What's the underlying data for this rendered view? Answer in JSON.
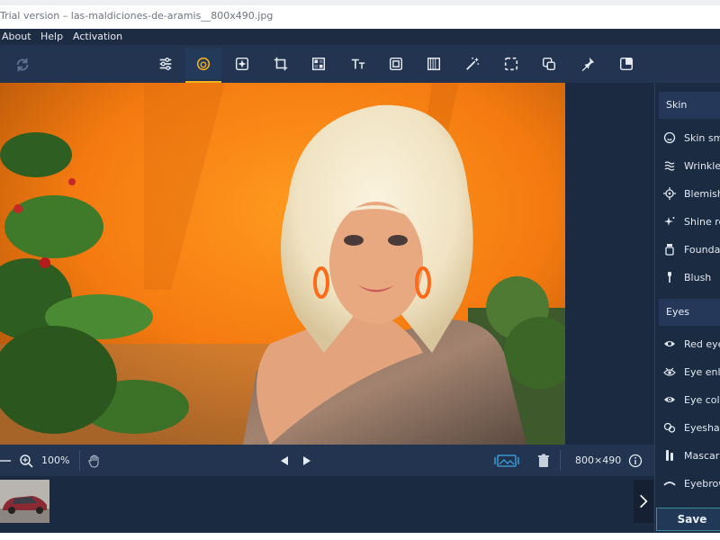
{
  "window": {
    "title": "Trial version – las-maldiciones-de-aramis__800x490.jpg"
  },
  "menu": {
    "items": [
      "About",
      "Help",
      "Activation"
    ]
  },
  "toolbar": {
    "undo_icon": "redo-icon",
    "tools": [
      {
        "name": "adjust-tool",
        "icon": "sliders-icon"
      },
      {
        "name": "retouch-tool",
        "icon": "face-retouch-icon",
        "active": true
      },
      {
        "name": "enhance-tool",
        "icon": "enhance-icon"
      },
      {
        "name": "crop-tool",
        "icon": "crop-icon"
      },
      {
        "name": "effects-tool",
        "icon": "effects-icon"
      },
      {
        "name": "text-tool",
        "icon": "text-icon"
      },
      {
        "name": "frame-tool",
        "icon": "frame-icon"
      },
      {
        "name": "vignette-tool",
        "icon": "vignette-icon"
      },
      {
        "name": "magic-wand-tool",
        "icon": "magic-wand-icon"
      },
      {
        "name": "selection-tool",
        "icon": "selection-icon"
      },
      {
        "name": "replace-tool",
        "icon": "replace-icon"
      },
      {
        "name": "pin-tool",
        "icon": "pin-icon"
      },
      {
        "name": "transform-tool",
        "icon": "transform-icon"
      }
    ],
    "accent_color": "#f2b01d"
  },
  "panel": {
    "skin_header": "Skin",
    "skin_items": [
      "Skin smo",
      "Wrinkle r",
      "Blemish",
      "Shine re",
      "Foundat",
      "Blush"
    ],
    "eyes_header": "Eyes",
    "eyes_items": [
      "Red eye",
      "Eye enla",
      "Eye colo",
      "Eyeshad",
      "Mascara",
      "Eyebrow"
    ],
    "save_label": "Save"
  },
  "statusbar": {
    "zoom": "100%",
    "dimensions": "800×490"
  }
}
